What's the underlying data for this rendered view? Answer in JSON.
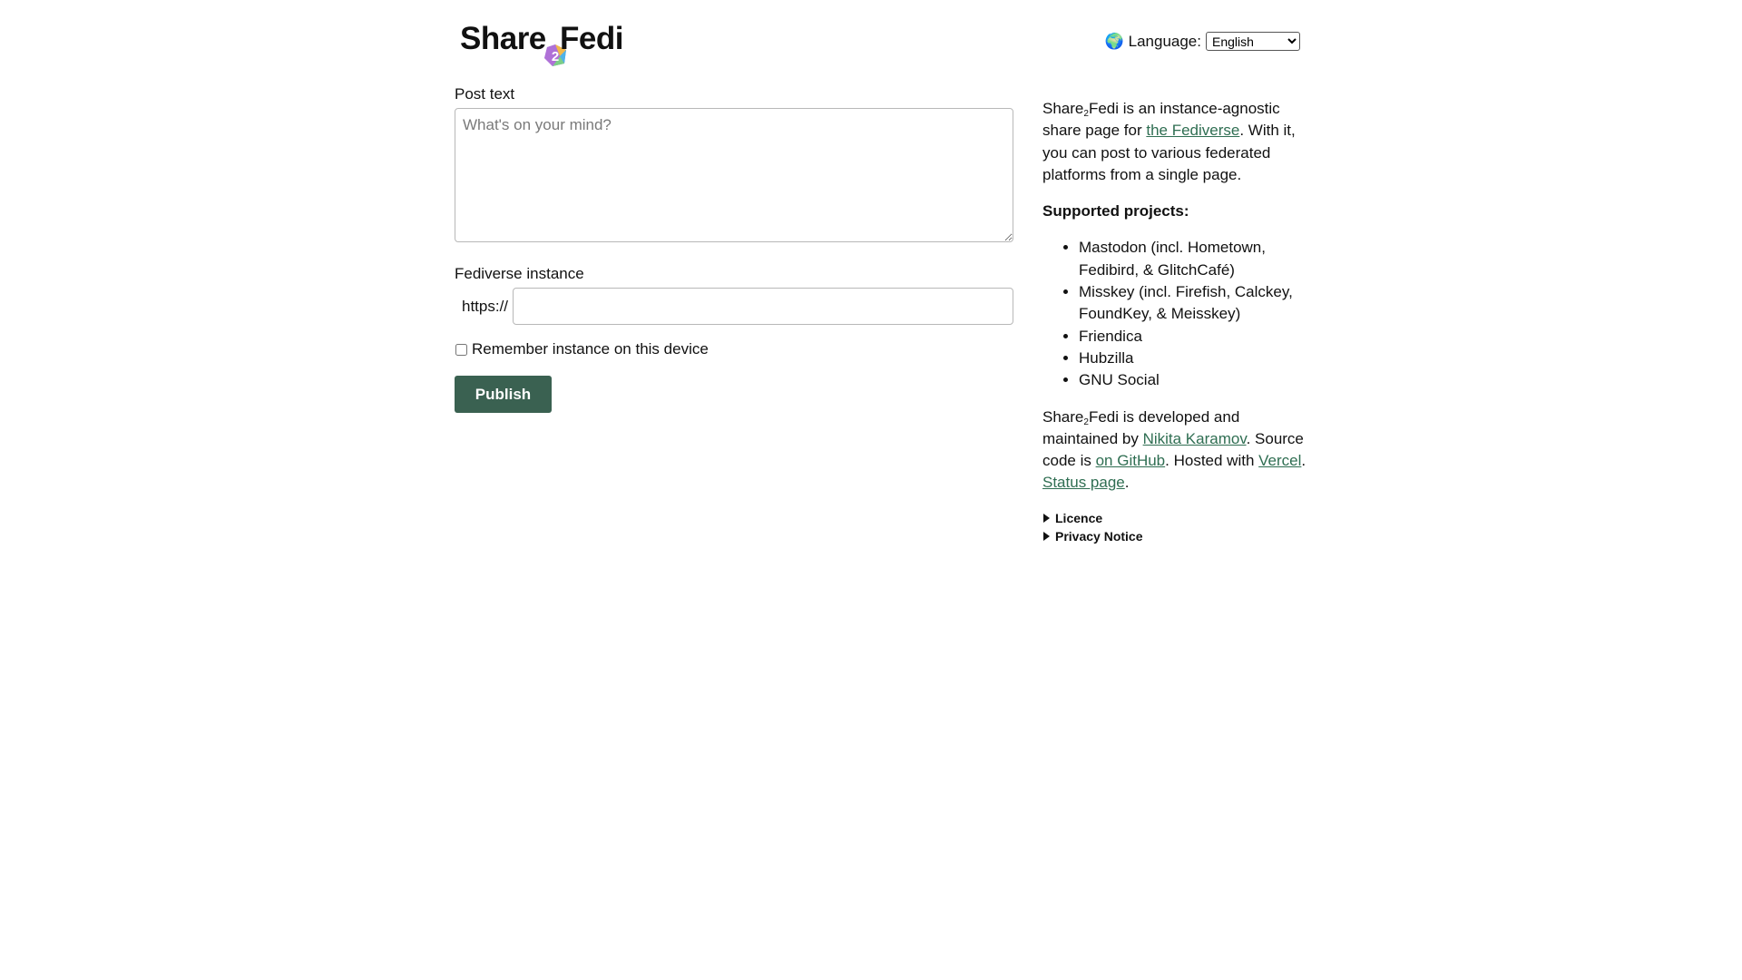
{
  "header": {
    "logo": {
      "left": "Share",
      "sub": "2",
      "right": "Fedi"
    },
    "language_label": "Language:",
    "language_selected": "English"
  },
  "form": {
    "post_text_label": "Post text",
    "post_text_placeholder": "What's on your mind?",
    "instance_label": "Fediverse instance",
    "instance_prefix": "https://",
    "instance_value": "",
    "remember_label": "Remember instance on this device",
    "remember_checked": false,
    "publish_label": "Publish"
  },
  "info": {
    "intro_name_a": "Share",
    "intro_name_sub": "2",
    "intro_name_b": "Fedi",
    "intro_1": " is an instance-agnostic share page for ",
    "intro_link": "the Fediverse",
    "intro_2": ". With it, you can post to various federated platforms from a single page.",
    "supported_heading": "Supported projects:",
    "projects": [
      "Mastodon (incl. Hometown, Fedibird, & GlitchCafé)",
      "Misskey (incl. Firefish, Calckey, FoundKey, & Meisskey)",
      "Friendica",
      "Hubzilla",
      "GNU Social"
    ],
    "dev_1": " is developed and maintained by ",
    "dev_link_author": "Nikita Karamov",
    "dev_2": ". Source code is ",
    "dev_link_github": "on GitHub",
    "dev_3": ". Hosted with ",
    "dev_link_vercel": "Vercel",
    "dev_4": ". ",
    "dev_link_status": "Status page",
    "dev_5": ".",
    "details": [
      "Licence",
      "Privacy Notice"
    ]
  },
  "colors": {
    "accent": "#3a6151",
    "link": "#2f6e52"
  }
}
